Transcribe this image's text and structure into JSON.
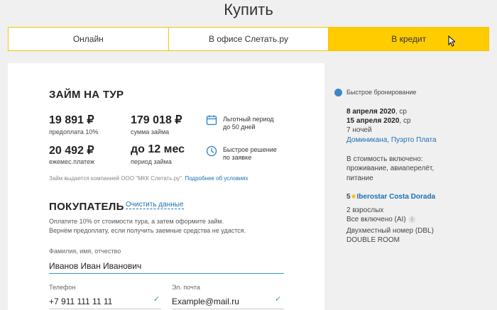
{
  "page": {
    "title": "Купить"
  },
  "tabs": [
    {
      "label": "Онлайн",
      "active": false
    },
    {
      "label": "В офисе Слетать.ру",
      "active": false
    },
    {
      "label": "В кредит",
      "active": true
    }
  ],
  "loan": {
    "title": "ЗАЙМ НА ТУР",
    "stats": [
      {
        "value": "19 891 ₽",
        "label": "предоплата 10%"
      },
      {
        "value": "179 018 ₽",
        "label": "сумма займа"
      },
      {
        "value": "20 492 ₽",
        "label": "ежемес.платеж"
      },
      {
        "value": "до 12 мес",
        "label": "период займа"
      }
    ],
    "benefits": [
      {
        "icon": "calendar-icon",
        "line1": "Льготный период",
        "line2": "до 50 дней"
      },
      {
        "icon": "clock-icon",
        "line1": "Быстрое решение",
        "line2": "по заявке"
      }
    ],
    "disclaimer": "Займ выдается компанией ООО \"МКК Слетать.ру\".",
    "disclaimer_link": "Подробнее об условиях"
  },
  "buyer": {
    "title": "ПОКУПАТЕЛЬ",
    "clear_label": "Очистить данные",
    "note_line1": "Оплатите 10% от стоимости тура, а затем оформите займ.",
    "note_line2": "Вернём предоплату, если получить заемные средства не удастся.",
    "fields": {
      "name": {
        "label": "Фамилия, имя, отчество",
        "value": "Иванов Иван Иванович"
      },
      "phone": {
        "label": "Телефон",
        "value": "+7 911 111 11 11"
      },
      "email": {
        "label": "Эл. почта",
        "value": "Example@mail.ru"
      }
    },
    "check_glyph": "✓"
  },
  "sidebar": {
    "quick_booking": "Быстрое бронирование",
    "date_from": "8 апреля 2020",
    "date_from_day": ", ср",
    "date_to": "15 апреля 2020",
    "date_to_day": ", ср",
    "nights": "7 ночей",
    "destination": "Доминикана, Пуэрто Плата",
    "included_title": "В стоимость включено:",
    "included_line1": "проживание, авиаперелёт,",
    "included_line2": "питание",
    "hotel_stars": "5",
    "star_glyph": "★",
    "hotel_name": "Iberostar Costa Dorada",
    "guests": "2 взрослых",
    "meal": "Все включено (AI)",
    "info_glyph": "i",
    "room_line1": "Двухместный номер (DBL)",
    "room_line2": "DOUBLE ROOM"
  },
  "colors": {
    "accent": "#ffcc00",
    "link": "#1a6fb5",
    "check": "#3aa64a"
  }
}
